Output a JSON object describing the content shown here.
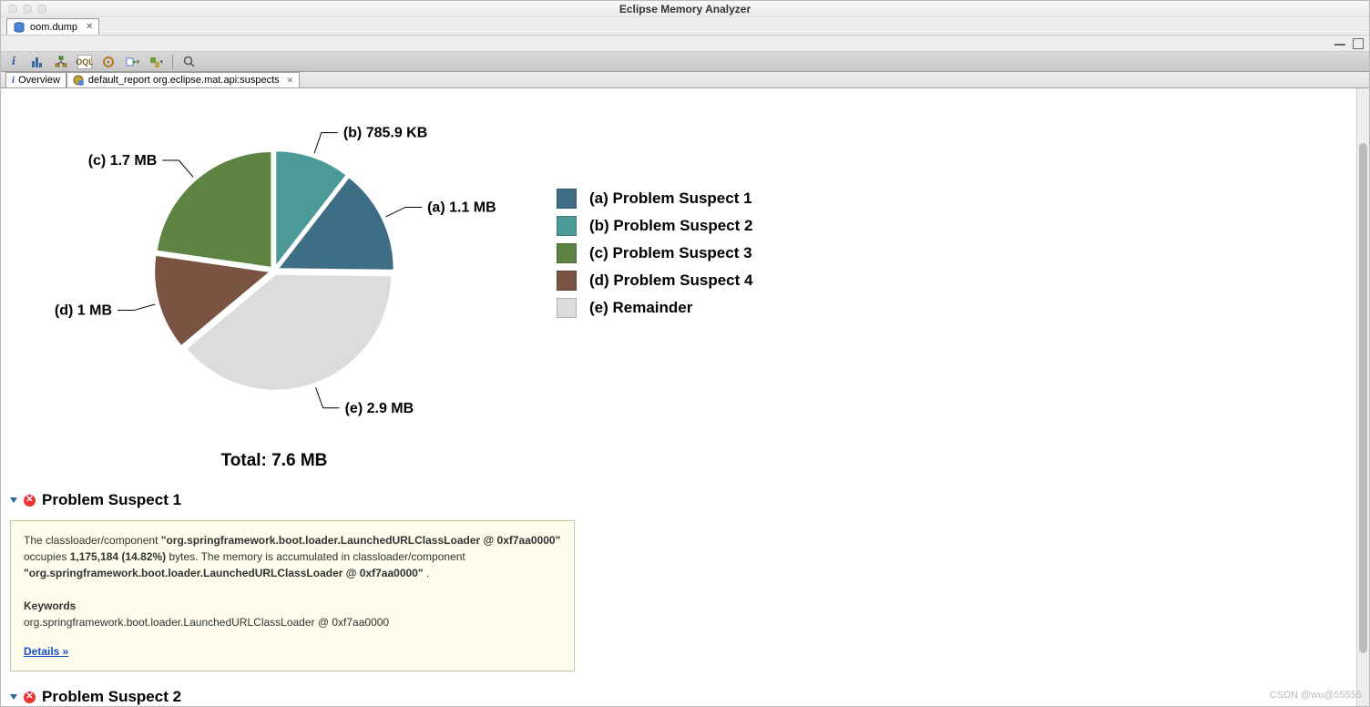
{
  "app_title": "Eclipse Memory Analyzer",
  "file_tab": {
    "label": "oom.dump"
  },
  "inner_tabs": {
    "overview": "Overview",
    "report": "default_report  org.eclipse.mat.api:suspects"
  },
  "chart_data": {
    "type": "pie",
    "title": "",
    "total_label": "Total: 7.6 MB",
    "slices": [
      {
        "id": "a",
        "label": "(a)  Problem Suspect 1",
        "callout": "(a)  1.1 MB",
        "value_mb": 1.1,
        "color": "#3d6e85"
      },
      {
        "id": "b",
        "label": "(b)  Problem Suspect 2",
        "callout": "(b)  785.9 KB",
        "value_mb": 0.7859,
        "color": "#4b9a97"
      },
      {
        "id": "c",
        "label": "(c)  Problem Suspect 3",
        "callout": "(c)  1.7 MB",
        "value_mb": 1.7,
        "color": "#5d8342"
      },
      {
        "id": "d",
        "label": "(d)  Problem Suspect 4",
        "callout": "(d)  1 MB",
        "value_mb": 1.0,
        "color": "#7a5443"
      },
      {
        "id": "e",
        "label": "(e)  Remainder",
        "callout": "(e)  2.9 MB",
        "value_mb": 2.9,
        "color": "#dcdcdc"
      }
    ]
  },
  "sections": {
    "s1": {
      "title": "Problem Suspect 1",
      "body_pre": "The classloader/component ",
      "body_bold1": "\"org.springframework.boot.loader.LaunchedURLClassLoader @ 0xf7aa0000\"",
      "body_mid1": " occupies ",
      "body_bold2": "1,175,184 (14.82%)",
      "body_mid2": " bytes. The memory is accumulated in classloader/component ",
      "body_bold3": "\"org.springframework.boot.loader.LaunchedURLClassLoader @ 0xf7aa0000\"",
      "body_end": ".",
      "keywords_label": "Keywords",
      "keywords_line": "org.springframework.boot.loader.LaunchedURLClassLoader @ 0xf7aa0000",
      "details": "Details »"
    },
    "s2": {
      "title": "Problem Suspect 2"
    }
  },
  "watermark": "CSDN @wu@55555"
}
